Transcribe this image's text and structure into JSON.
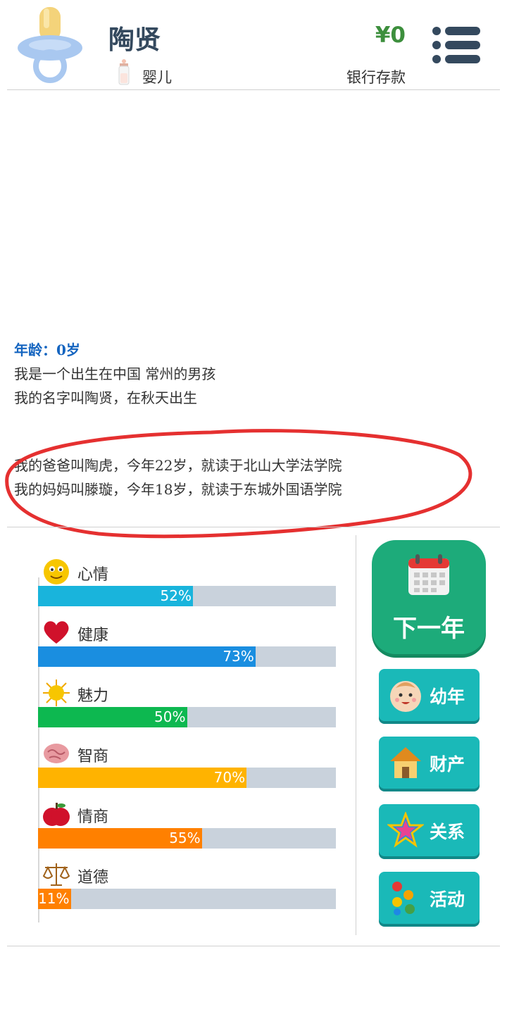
{
  "header": {
    "name": "陶贤",
    "stage": "婴儿",
    "money": "¥0",
    "money_label": "银行存款"
  },
  "story": {
    "age_line": "年龄：0岁",
    "lines": [
      "我是一个出生在中国 常州的男孩",
      "我的名字叫陶贤，在秋天出生"
    ],
    "parents": [
      "我的爸爸叫陶虎，今年22岁，就读于北山大学法学院",
      "我的妈妈叫滕璇，今年18岁，就读于东城外国语学院"
    ]
  },
  "stats": [
    {
      "label": "心情",
      "value": 52,
      "pct": "52%",
      "color": "#19b4dc",
      "icon": "smiley-icon"
    },
    {
      "label": "健康",
      "value": 73,
      "pct": "73%",
      "color": "#1a8ee0",
      "icon": "heart-icon"
    },
    {
      "label": "魅力",
      "value": 50,
      "pct": "50%",
      "color": "#0db850",
      "icon": "sun-icon"
    },
    {
      "label": "智商",
      "value": 70,
      "pct": "70%",
      "color": "#ffb300",
      "icon": "brain-icon"
    },
    {
      "label": "情商",
      "value": 55,
      "pct": "55%",
      "color": "#ff8000",
      "icon": "apple-icon"
    },
    {
      "label": "道德",
      "value": 11,
      "pct": "11%",
      "color": "#ff8000",
      "icon": "scale-icon"
    }
  ],
  "actions": {
    "next_year": "下一年",
    "childhood": "幼年",
    "assets": "财产",
    "relations": "关系",
    "activities": "活动"
  },
  "colors": {
    "annotation_circle": "#e53030",
    "next_year_bg": "#1dab7a",
    "side_button_bg": "#1ab9b8"
  }
}
